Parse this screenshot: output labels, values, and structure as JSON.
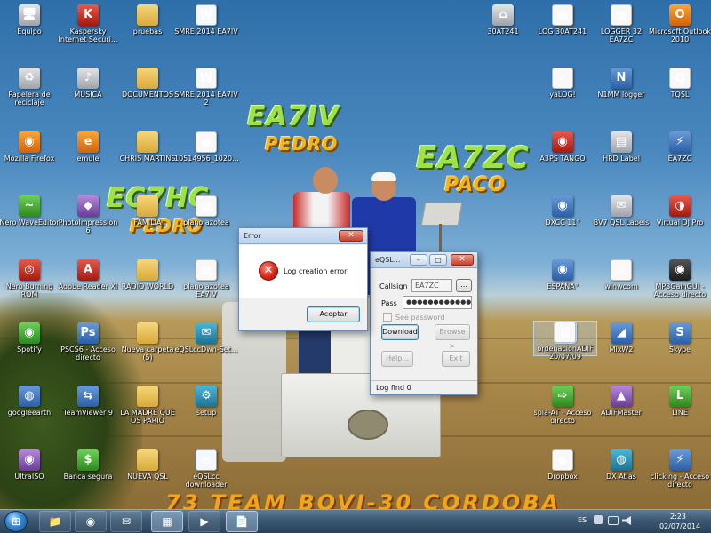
{
  "overlays": {
    "ea7iv": "EA7IV",
    "pedro1": "PEDRO",
    "ea7zc": "EA7ZC",
    "paco": "PACO",
    "ec7hc": "EC7HC",
    "pedro2": "PEDRO",
    "banner": "73 TEAM BOVI-30 CORDOBA"
  },
  "icons": [
    {
      "label": "Equipo",
      "glyph": "🖥",
      "style": "g-grey"
    },
    {
      "label": "Kaspersky Internet Securi...",
      "glyph": "K",
      "style": "g-red"
    },
    {
      "label": "pruebas",
      "glyph": "",
      "style": "g-folder"
    },
    {
      "label": "SMRE 2014 EA7IV",
      "glyph": "W",
      "style": "g-doc"
    },
    {
      "label": "Papelera de reciclaje",
      "glyph": "♻",
      "style": "g-grey"
    },
    {
      "label": "MUSICA",
      "glyph": "♪",
      "style": "g-grey"
    },
    {
      "label": "DOCUMENTOS",
      "glyph": "",
      "style": "g-folder"
    },
    {
      "label": "SMRE 2014 EA7IV 2",
      "glyph": "W",
      "style": "g-doc"
    },
    {
      "label": "Mozilla Firefox",
      "glyph": "◉",
      "style": "g-orange"
    },
    {
      "label": "emule",
      "glyph": "e",
      "style": "g-orange"
    },
    {
      "label": "CHRIS MARTINS",
      "glyph": "",
      "style": "g-folder"
    },
    {
      "label": "10514956_1020...",
      "glyph": "●",
      "style": "g-white"
    },
    {
      "label": "Nero WaveEditor",
      "glyph": "~",
      "style": "g-green"
    },
    {
      "label": "PhotoImpression 6",
      "glyph": "◆",
      "style": "g-purple"
    },
    {
      "label": "FAMILIA",
      "glyph": "",
      "style": "g-folder"
    },
    {
      "label": "plano azotea",
      "glyph": "▦",
      "style": "g-white"
    },
    {
      "label": "Nero Burning ROM",
      "glyph": "◎",
      "style": "g-red"
    },
    {
      "label": "Adobe Reader XI",
      "glyph": "A",
      "style": "g-red"
    },
    {
      "label": "RADIO WORLD",
      "glyph": "",
      "style": "g-folder"
    },
    {
      "label": "plano azotea EA7IV",
      "glyph": "▦",
      "style": "g-white"
    },
    {
      "label": "Spotify",
      "glyph": "◉",
      "style": "g-green"
    },
    {
      "label": "PSCS6 - Acceso directo",
      "glyph": "Ps",
      "style": "g-app"
    },
    {
      "label": "Nueva carpeta (5)",
      "glyph": "",
      "style": "g-folder"
    },
    {
      "label": "eQSLccDwn-Set...",
      "glyph": "✉",
      "style": "g-teal"
    },
    {
      "label": "googleearth",
      "glyph": "◍",
      "style": "g-app"
    },
    {
      "label": "TeamViewer 9",
      "glyph": "⇆",
      "style": "g-app"
    },
    {
      "label": "LA MADRE QUE OS PARIO",
      "glyph": "",
      "style": "g-folder"
    },
    {
      "label": "setup",
      "glyph": "⚙",
      "style": "g-teal"
    },
    {
      "label": "UltraISO",
      "glyph": "◉",
      "style": "g-purple"
    },
    {
      "label": "Banca segura",
      "glyph": "$",
      "style": "g-green"
    },
    {
      "label": "NUEVA QSL",
      "glyph": "",
      "style": "g-folder"
    },
    {
      "label": "eQSLcc downloader",
      "glyph": "✉",
      "style": "g-doc"
    },
    {
      "label": "30AT241",
      "glyph": "⌂",
      "style": "g-grey"
    },
    {
      "label": "LOG 30AT241",
      "glyph": "▦",
      "style": "g-white"
    },
    {
      "label": "LOGGER 32 EA7ZC",
      "glyph": "▦",
      "style": "g-white"
    },
    {
      "label": "Microsoft Outlook 2010",
      "glyph": "O",
      "style": "g-orange"
    },
    {
      "label": "yaLOG!",
      "glyph": "✓",
      "style": "g-white"
    },
    {
      "label": "N1MM logger",
      "glyph": "N",
      "style": "g-app"
    },
    {
      "label": "TQSL",
      "glyph": "Q",
      "style": "g-white"
    },
    {
      "label": "A3PS TANGO",
      "glyph": "◉",
      "style": "g-red"
    },
    {
      "label": "HRD Label",
      "glyph": "▤",
      "style": "g-grey"
    },
    {
      "label": "EA7ZC",
      "glyph": "⚡",
      "style": "g-app"
    },
    {
      "label": "DXCC 11°",
      "glyph": "◉",
      "style": "g-app"
    },
    {
      "label": "BV7 QSL Labels",
      "glyph": "✉",
      "style": "g-grey"
    },
    {
      "label": "Virtual DJ Pro",
      "glyph": "◑",
      "style": "g-red"
    },
    {
      "label": "ESPAÑA°",
      "glyph": "◉",
      "style": "g-app"
    },
    {
      "label": "winwcom",
      "glyph": "◎",
      "style": "g-white"
    },
    {
      "label": "MP3GainGUI - Acceso directo",
      "glyph": "◉",
      "style": "g-dark"
    },
    {
      "label": "ordenacionADIF 20/07/09",
      "glyph": "▤",
      "style": "g-white"
    },
    {
      "label": "MixW2",
      "glyph": "◢",
      "style": "g-app"
    },
    {
      "label": "Skype",
      "glyph": "S",
      "style": "g-app"
    },
    {
      "label": "spla-AT - Acceso directo",
      "glyph": "⇨",
      "style": "g-green"
    },
    {
      "label": "ADIFMaster",
      "glyph": "▲",
      "style": "g-purple"
    },
    {
      "label": "LINE",
      "glyph": "L",
      "style": "g-green"
    },
    {
      "label": "Dropbox",
      "glyph": "◆",
      "style": "g-white"
    },
    {
      "label": "DX Atlas",
      "glyph": "◍",
      "style": "g-teal"
    },
    {
      "label": "clicking - Acceso directo",
      "glyph": "⚡",
      "style": "g-app"
    }
  ],
  "error_dialog": {
    "title": "Error",
    "message": "Log creation error",
    "accept": "Aceptar",
    "close": "✕"
  },
  "eqsl_dialog": {
    "title": "eQSL...",
    "callsign_label": "Callsign",
    "callsign_value": "EA7ZC",
    "pass_label": "Pass",
    "pass_value": "●●●●●●●●●●●●●●",
    "see_password": "See password",
    "browse_small": "...",
    "download": "Download",
    "browse": "Browse >",
    "help": "Help...",
    "exit": "Exit",
    "log_find": "Log find  0",
    "min": "–",
    "max": "□",
    "close": "✕"
  },
  "taskbar": {
    "start": "⊞",
    "buttons": [
      "📁",
      "◉",
      "✉",
      "▦",
      "▶",
      "📄"
    ],
    "lang": "ES",
    "time": "2:23",
    "date": "02/07/2014"
  }
}
